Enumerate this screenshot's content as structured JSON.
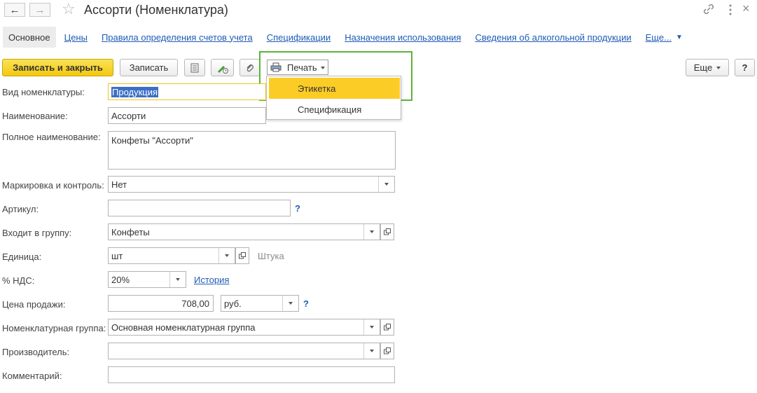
{
  "window": {
    "title": "Ассорти (Номенклатура)"
  },
  "tabs": {
    "active": "Основное",
    "items": [
      "Цены",
      "Правила определения счетов учета",
      "Спецификации",
      "Назначения использования",
      "Сведения об алкогольной продукции"
    ],
    "more": "Еще..."
  },
  "toolbar": {
    "save_close": "Записать и закрыть",
    "save": "Записать",
    "print": "Печать",
    "more": "Еще",
    "help": "?"
  },
  "print_menu": {
    "items": [
      "Этикетка",
      "Спецификация"
    ]
  },
  "form": {
    "vid": {
      "label": "Вид номенклатуры:",
      "value": "Продукция"
    },
    "name": {
      "label": "Наименование:",
      "value": "Ассорти"
    },
    "full_name": {
      "label": "Полное наименование:",
      "value": "Конфеты \"Ассорти\""
    },
    "marking": {
      "label": "Маркировка и контроль:",
      "value": "Нет"
    },
    "article": {
      "label": "Артикул:",
      "value": "",
      "help": "?"
    },
    "group": {
      "label": "Входит в группу:",
      "value": "Конфеты"
    },
    "unit": {
      "label": "Единица:",
      "value": "шт",
      "hint": "Штука"
    },
    "vat": {
      "label": "% НДС:",
      "value": "20%",
      "history_link": "История"
    },
    "price": {
      "label": "Цена продажи:",
      "value": "708,00",
      "currency": "руб.",
      "help": "?"
    },
    "nom_group": {
      "label": "Номенклатурная группа:",
      "value": "Основная номенклатурная группа"
    },
    "producer": {
      "label": "Производитель:",
      "value": ""
    },
    "comment": {
      "label": "Комментарий:",
      "value": ""
    }
  },
  "colors": {
    "accent_yellow": "#f3c80f",
    "link_blue": "#1f5bb5",
    "highlight_green": "#5bb339",
    "menu_active": "#fbcc26"
  }
}
